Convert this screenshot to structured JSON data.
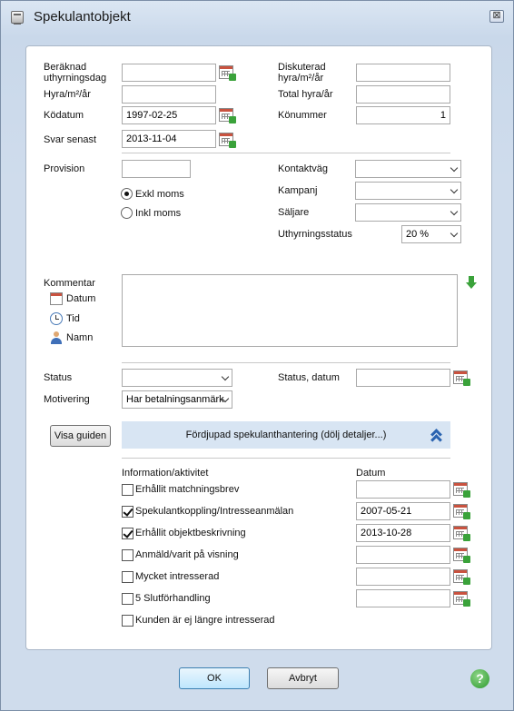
{
  "window": {
    "title": "Spekulantobjekt",
    "close_label": "⊠"
  },
  "fields": {
    "beraknad_label_1": "Beräknad",
    "beraknad_label_2": "uthyrningsdag",
    "beraknad_value": "",
    "hyra_label": "Hyra/m²/år",
    "hyra_value": "",
    "kodatum_label": "Ködatum",
    "kodatum_value": "1997-02-25",
    "svar_label": "Svar senast",
    "svar_value": "2013-11-04",
    "diskuterad_label_1": "Diskuterad",
    "diskuterad_label_2": "hyra/m²/år",
    "diskuterad_value": "",
    "total_label": "Total hyra/år",
    "total_value": "",
    "konummer_label": "Könummer",
    "konummer_value": "1"
  },
  "provision": {
    "label": "Provision",
    "value": "",
    "radio_exkl": "Exkl moms",
    "radio_inkl": "Inkl moms",
    "selected": "Exkl moms"
  },
  "selects": {
    "kontaktvag_label": "Kontaktväg",
    "kontaktvag_value": "",
    "kampanj_label": "Kampanj",
    "kampanj_value": "",
    "saljare_label": "Säljare",
    "saljare_value": "",
    "uthyrningsstatus_label": "Uthyrningsstatus",
    "uthyrningsstatus_value": "20 %"
  },
  "kommentar": {
    "label": "Kommentar",
    "datum": "Datum",
    "tid": "Tid",
    "namn": "Namn",
    "value": ""
  },
  "status": {
    "status_label": "Status",
    "status_value": "",
    "motivering_label": "Motivering",
    "motivering_value": "Har betalningsanmärk",
    "status_datum_label": "Status, datum",
    "status_datum_value": ""
  },
  "guide": {
    "button": "Visa guiden",
    "banner": "Fördjupad spekulanthantering (dölj detaljer...)"
  },
  "activities": {
    "header_info": "Information/aktivitet",
    "header_datum": "Datum",
    "items": [
      {
        "label": "Erhållit matchningsbrev",
        "checked": false,
        "date": ""
      },
      {
        "label": "Spekulantkoppling/Intresseanmälan",
        "checked": true,
        "date": "2007-05-21"
      },
      {
        "label": "Erhållit objektbeskrivning",
        "checked": true,
        "date": "2013-10-28"
      },
      {
        "label": "Anmäld/varit på visning",
        "checked": false,
        "date": ""
      },
      {
        "label": "Mycket intresserad",
        "checked": false,
        "date": ""
      },
      {
        "label": "5 Slutförhandling",
        "checked": false,
        "date": ""
      },
      {
        "label": "Kunden är ej längre intresserad",
        "checked": false
      }
    ]
  },
  "buttons": {
    "ok": "OK",
    "cancel": "Avbryt",
    "help": "?"
  }
}
